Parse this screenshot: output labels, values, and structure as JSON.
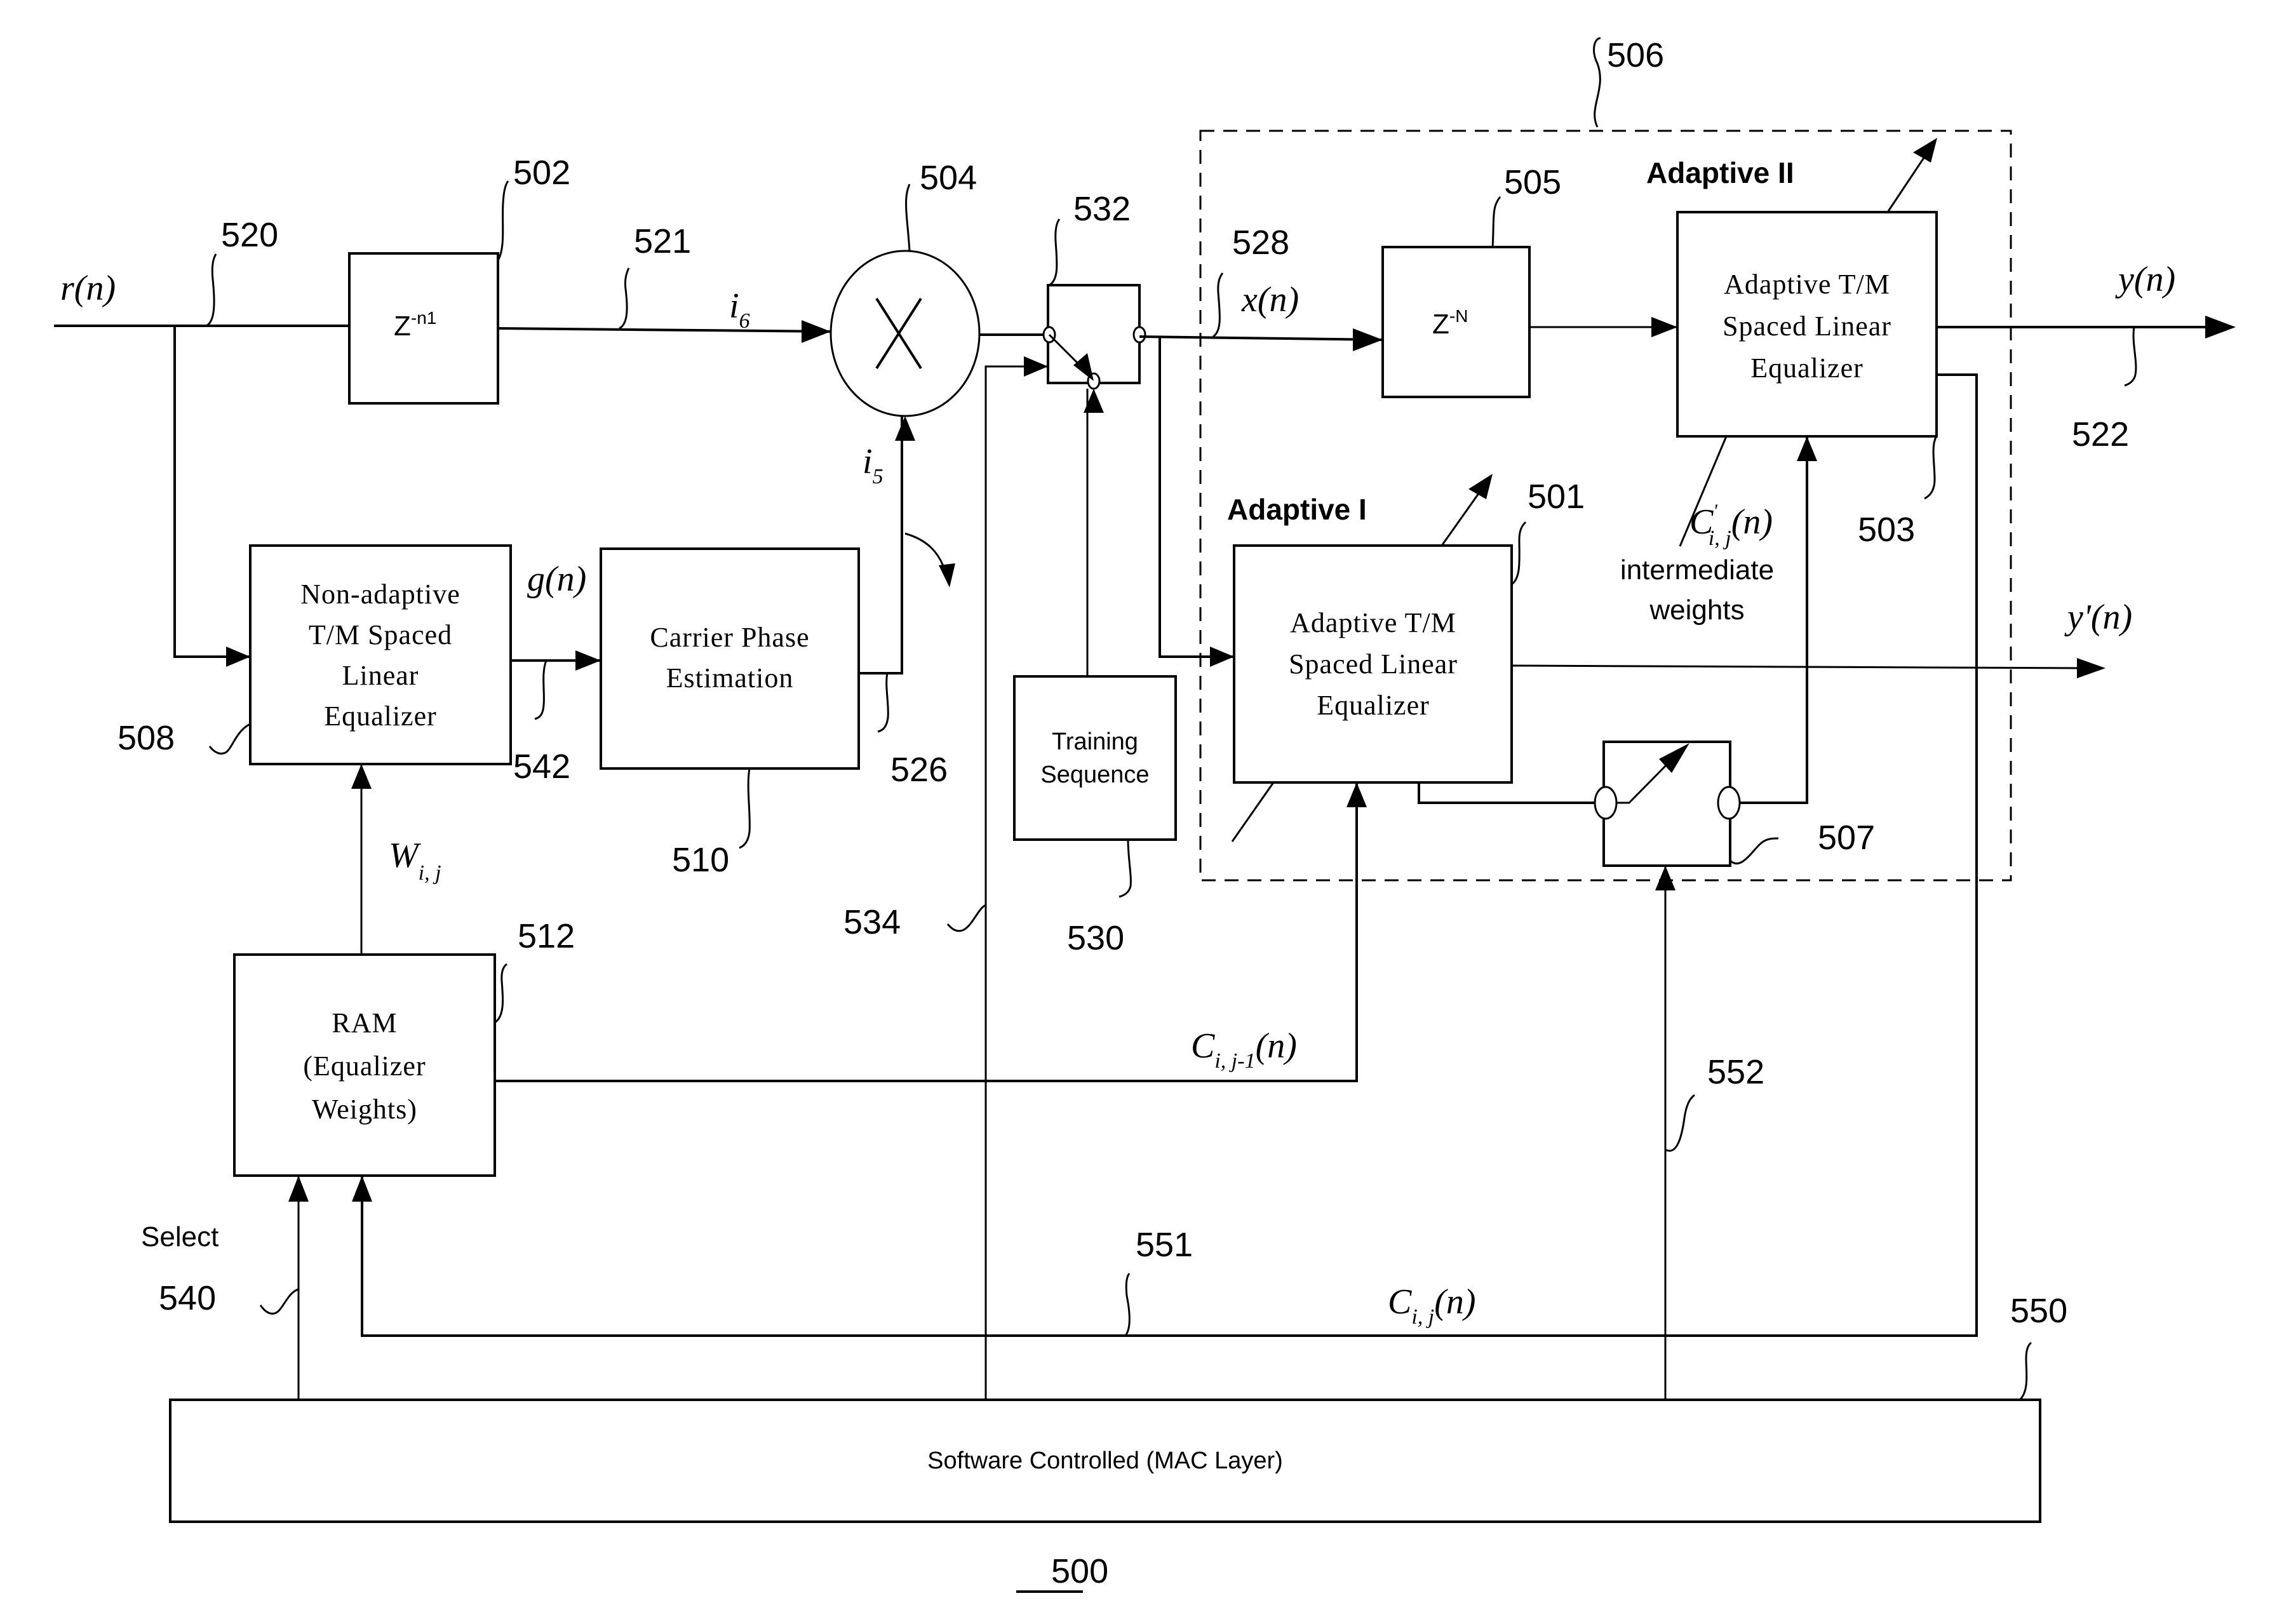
{
  "figure": {
    "number": "500",
    "container_label": "506"
  },
  "signals": {
    "input": {
      "name": "r",
      "arg": "n"
    },
    "delayed": {
      "name": "i",
      "sub": "6"
    },
    "phase": {
      "name": "i",
      "sub": "5"
    },
    "g": {
      "name": "g",
      "arg": "n"
    },
    "x": {
      "name": "x",
      "arg": "n"
    },
    "y": {
      "name": "y",
      "arg": "n"
    },
    "y_prime": {
      "name": "y'",
      "arg": "n"
    },
    "w": {
      "name": "W",
      "sub": "i, j"
    },
    "c_prev": {
      "name": "C",
      "sub": "i, j-1",
      "arg": "n"
    },
    "c_inter": {
      "name": "C",
      "sup": "'",
      "sub": "i, j",
      "arg": "n",
      "caption_line1": "intermediate",
      "caption_line2": "weights"
    },
    "c_final": {
      "name": "C",
      "sub": "i, j",
      "arg": "n"
    }
  },
  "blocks": {
    "delay1": {
      "base": "Z",
      "exp": "-n1",
      "ref": "502"
    },
    "multiplier": {
      "symbol": "×",
      "ref": "504"
    },
    "switch_in": {
      "ref": "532"
    },
    "delayN": {
      "base": "Z",
      "exp": "-N",
      "ref": "505"
    },
    "adaptive2": {
      "title": "Adaptive II",
      "lines": [
        "Adaptive T/M",
        "Spaced Linear",
        "Equalizer"
      ],
      "ref": "503"
    },
    "adaptive1": {
      "title": "Adaptive I",
      "lines": [
        "Adaptive T/M",
        "Spaced Linear",
        "Equalizer"
      ],
      "ref": "501"
    },
    "switch_weights": {
      "ref": "507"
    },
    "nonadaptive": {
      "lines": [
        "Non-adaptive",
        "T/M Spaced",
        "Linear",
        "Equalizer"
      ],
      "ref": "508"
    },
    "carrier": {
      "lines": [
        "Carrier Phase",
        "Estimation"
      ],
      "ref": "510"
    },
    "training": {
      "lines": [
        "Training",
        "Sequence"
      ],
      "ref": "530"
    },
    "ram": {
      "lines": [
        "RAM",
        "(Equalizer",
        "Weights)"
      ],
      "ref": "512"
    },
    "mac": {
      "label": "Software Controlled (MAC Layer)",
      "ref": "550"
    }
  },
  "refs": {
    "r_line": "520",
    "i6_line": "521",
    "y_line": "522",
    "x_line": "528",
    "g_line": "542",
    "phase_line": "526",
    "ctrl_534": "534",
    "select_line": "540",
    "c_return": "551",
    "switch_ctrl": "552"
  },
  "labels": {
    "select": "Select"
  }
}
